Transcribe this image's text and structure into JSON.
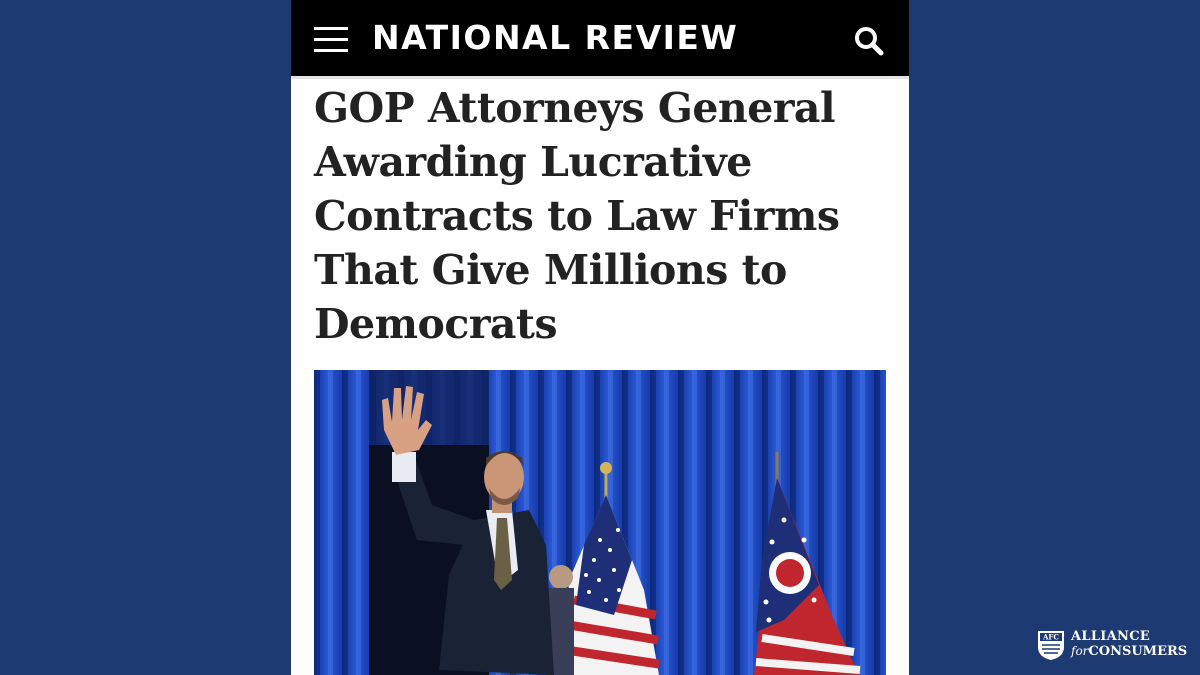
{
  "site": {
    "brand": "NATIONAL REVIEW",
    "menu_icon": "hamburger-menu-icon",
    "search_icon": "search-icon"
  },
  "article": {
    "headline": "GOP Attorneys General Awarding Lucrative Contracts to Law Firms That Give Millions to Democrats",
    "photo_description": "A man in a dark suit waving on stage in front of blue curtains with a U.S. flag and an Ohio flag"
  },
  "watermark": {
    "badge": "AFC",
    "line1": "ALLIANCE",
    "line2_prefix": "for",
    "line2_main": "CONSUMERS"
  },
  "colors": {
    "background": "#1d3a72",
    "topbar": "#000000",
    "headline": "#222222",
    "curtain": "#1b45b8"
  }
}
